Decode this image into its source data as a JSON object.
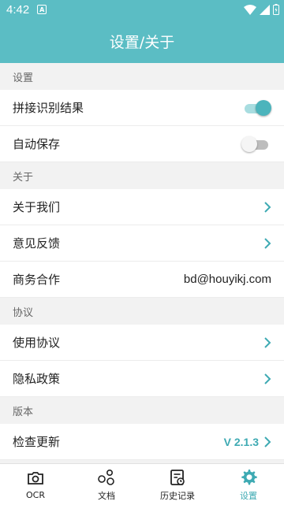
{
  "status_bar": {
    "time": "4:42",
    "notification_glyph": "A"
  },
  "app_bar": {
    "title": "设置/关于"
  },
  "sections": {
    "settings": {
      "header": "设置",
      "stitch_label": "拼接识别结果",
      "stitch_on": true,
      "autosave_label": "自动保存",
      "autosave_on": false
    },
    "about": {
      "header": "关于",
      "about_us_label": "关于我们",
      "feedback_label": "意见反馈",
      "business_label": "商务合作",
      "business_email": "bd@houyikj.com"
    },
    "agreement": {
      "header": "协议",
      "terms_label": "使用协议",
      "privacy_label": "隐私政策"
    },
    "version": {
      "header": "版本",
      "check_update_label": "检查更新",
      "version_value": "V 2.1.3"
    }
  },
  "bottom_nav": {
    "ocr": "OCR",
    "documents": "文档",
    "history": "历史记录",
    "settings": "设置"
  },
  "colors": {
    "accent": "#5bbdc4",
    "accent_dark": "#3eaab3"
  }
}
